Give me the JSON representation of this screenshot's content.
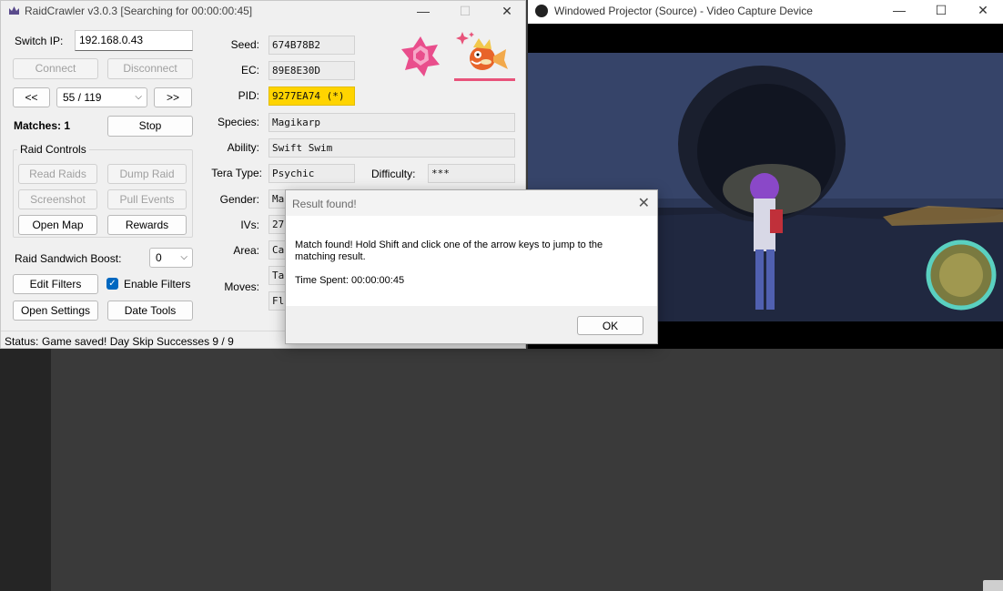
{
  "raidcrawler": {
    "title": "RaidCrawler v3.0.3  [Searching for 00:00:00:45]",
    "controls": {
      "minimize": "—",
      "maximize": "☐",
      "close": "✕"
    },
    "switch_ip_label": "Switch IP:",
    "switch_ip_value": "192.168.0.43",
    "connect": "Connect",
    "disconnect": "Disconnect",
    "prev": "<<",
    "next": ">>",
    "page_select": "55 / 119",
    "matches": "Matches: 1",
    "stop": "Stop",
    "raid_controls_title": "Raid Controls",
    "read_raids": "Read Raids",
    "dump_raid": "Dump Raid",
    "screenshot": "Screenshot",
    "pull_events": "Pull Events",
    "open_map": "Open Map",
    "rewards": "Rewards",
    "sandwich_label": "Raid Sandwich Boost:",
    "sandwich_value": "0",
    "edit_filters": "Edit Filters",
    "enable_filters": "Enable Filters",
    "open_settings": "Open Settings",
    "date_tools": "Date Tools",
    "status_label": "Status:",
    "status_text": "Game saved!  Day Skip Successes 9 / 9",
    "fields": {
      "seed_label": "Seed:",
      "seed": "674B78B2",
      "ec_label": "EC:",
      "ec": "89E8E30D",
      "pid_label": "PID:",
      "pid": "9277EA74 (*)",
      "species_label": "Species:",
      "species": "Magikarp",
      "ability_label": "Ability:",
      "ability": "Swift Swim",
      "tera_label": "Tera Type:",
      "tera": "Psychic",
      "difficulty_label": "Difficulty:",
      "difficulty": "***",
      "gender_label": "Gender:",
      "gender": "Ma",
      "ivs_label": "IVs:",
      "ivs": "27",
      "area_label": "Area:",
      "area": "Ca",
      "moves_label": "Moves:",
      "move1": "Ta",
      "move2": "Fl"
    },
    "colors": {
      "pid_highlight": "#ffd400",
      "tera_icon": "#e94e8c",
      "shiny_accent": "#e8537a"
    }
  },
  "projector": {
    "title": "Windowed Projector (Source) - Video Capture Device",
    "controls": {
      "minimize": "—",
      "maximize": "☐",
      "close": "✕"
    }
  },
  "dialog": {
    "title": "Result found!",
    "message": "Match found! Hold Shift and click one of the arrow keys to jump to the matching result.",
    "time_spent": "Time Spent: 00:00:00:45",
    "ok": "OK",
    "close": "✕"
  }
}
